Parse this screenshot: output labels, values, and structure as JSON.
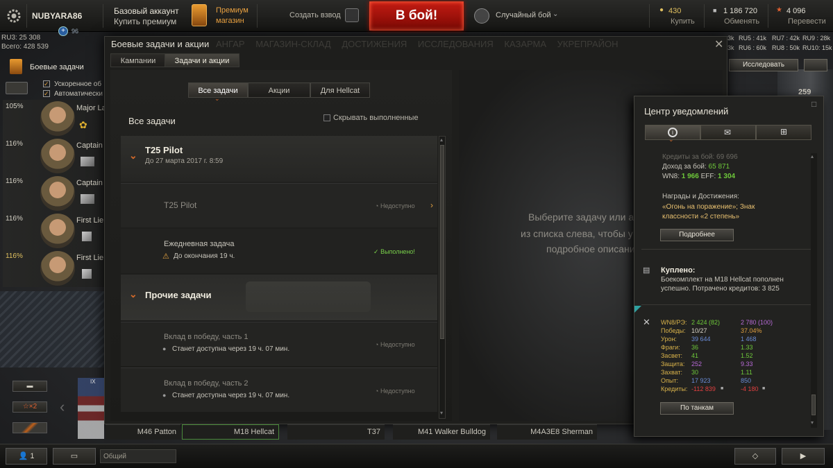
{
  "topbar": {
    "player_name": "NUBYARA86",
    "clan_badge": "96",
    "account_type": "Базовый аккаунт",
    "buy_premium": "Купить премиум",
    "premium_shop_line1": "Премиум",
    "premium_shop_line2": "магазин",
    "create_platoon": "Создать взвод",
    "battle_button": "В бой!",
    "battle_mode": "Случайный бой",
    "gold": "430",
    "gold_action": "Купить",
    "credits": "1 186 720",
    "credits_action": "Обменять",
    "free_xp": "4 096",
    "free_xp_action": "Перевести"
  },
  "left_stats": {
    "ru3": "RU3: 25 308",
    "total": "Всего: 428 539"
  },
  "left_menu": {
    "missions_label": "Боевые задачи",
    "option_accelerated": "Ускоренное об",
    "option_auto": "Автоматически"
  },
  "crew": [
    {
      "percent": "105%",
      "rank": "Major La"
    },
    {
      "percent": "116%",
      "rank": "Captain"
    },
    {
      "percent": "116%",
      "rank": "Captain"
    },
    {
      "percent": "116%",
      "rank": "First Lie"
    },
    {
      "percent": "116%",
      "rank": "First Lie"
    }
  ],
  "server_stats": {
    "ru5": "RU5 : 41k",
    "ru7": "RU7 : 42k",
    "ru9": "RU9 : 28k",
    "ru6": "RU6 : 60k",
    "ru8": "RU8 : 50k",
    "ru10": "RU10: 15k",
    "left_a": "3k",
    "left_b": "3k"
  },
  "garage_menu": {
    "items": [
      "АНГАР",
      "МАГАЗИН-СКЛАД",
      "ДОСТИЖЕНИЯ",
      "ИССЛЕДОВАНИЯ",
      "КАЗАРМА",
      "УКРЕПРАЙОН"
    ],
    "research_button": "Исследовать",
    "tank_name_bg": "Hellcat",
    "tank_level_num": "259"
  },
  "modal": {
    "title": "Боевые задачи и акции",
    "tabs": [
      "Кампании",
      "Задачи и акции"
    ],
    "filter_tabs": [
      "Все задачи",
      "Акции",
      "Для Hellcat"
    ],
    "section_title": "Все задачи",
    "hide_completed": "Скрывать выполненные",
    "group1_title": "T25 Pilot",
    "group1_date": "До 27 марта 2017 г. 8:59",
    "task1_name": "T25 Pilot",
    "task1_status": "Недоступно",
    "task2_name": "Ежедневная задача",
    "task2_sub": "До окончания 19 ч.",
    "task2_status": "Выполнено!",
    "group2_title": "Прочие задачи",
    "task3_name": "Вклад в победу, часть 1",
    "task3_sub": "Станет доступна через 19 ч. 07 мин.",
    "task3_status": "Недоступно",
    "task4_name": "Вклад в победу, часть 2",
    "task4_sub": "Станет доступна через 19 ч. 07 мин.",
    "task4_status": "Недоступно",
    "detail_line1": "Выберите задачу или ак",
    "detail_line2": "из списка слева, чтобы у",
    "detail_line3": "подробное описани"
  },
  "notifications": {
    "title": "Центр уведомлений",
    "credits_battle": "Кредиты за бой: 69 696",
    "income_label": "Доход за бой:",
    "income_value": "65 871",
    "wn8_label": "WN8:",
    "wn8_value": "1 966",
    "eff_label": "EFF:",
    "eff_value": "1 304",
    "awards_label": "Награды и Достижения:",
    "awards_line1": "«Огонь на поражение»; Знак",
    "awards_line2": "классности «2 степень»",
    "details_button": "Подробнее",
    "purchased_title": "Куплено:",
    "purchased_line1": "Боекомплект на M18 Hellcat пополнен",
    "purchased_line2": "успешно. Потрачено кредитов:",
    "purchased_value": "3 825",
    "stats_rows": [
      {
        "key": "WN8/РЭ:",
        "v1": "2 424 (82)",
        "v2": "2 780 (100)",
        "c1": "#6ec93a",
        "c2": "#b76ad6"
      },
      {
        "key": "Победы:",
        "v1": "10/27",
        "v2": "37.04%",
        "c1": "#d8d4c8",
        "c2": "#e0a040"
      },
      {
        "key": "Урон:",
        "v1": "39 644",
        "v2": "1 468",
        "c1": "#6a8cd6",
        "c2": "#6a8cd6"
      },
      {
        "key": "Фраги:",
        "v1": "36",
        "v2": "1.33",
        "c1": "#6ec93a",
        "c2": "#6ec93a"
      },
      {
        "key": "Засвет:",
        "v1": "41",
        "v2": "1.52",
        "c1": "#6ec93a",
        "c2": "#6ec93a"
      },
      {
        "key": "Защита:",
        "v1": "252",
        "v2": "9.33",
        "c1": "#b76ad6",
        "c2": "#b76ad6"
      },
      {
        "key": "Захват:",
        "v1": "30",
        "v2": "1.11",
        "c1": "#6ec93a",
        "c2": "#6ec93a"
      },
      {
        "key": "Опыт:",
        "v1": "17 923",
        "v2": "850",
        "c1": "#6a8cd6",
        "c2": "#6a8cd6"
      },
      {
        "key": "Кредиты:",
        "v1": "-112 839",
        "v2": "-4 180",
        "c1": "#e04040",
        "c2": "#e04040"
      }
    ],
    "by_tanks_button": "По танкам"
  },
  "carousel": {
    "tanks": [
      "M46 Patton",
      "M18 Hellcat",
      "T37",
      "M41 Walker Bulldog",
      "M4A3E8 Sherman"
    ],
    "tier_badge": "IX",
    "xp_bonus": "×2"
  },
  "bottombar": {
    "friends_count": "1",
    "chat_channel": "Общий"
  },
  "colors": {
    "accent_orange": "#d46a2a",
    "battle_red": "#c21b12",
    "gold": "#e0c060",
    "completed_green": "#7ad14a"
  }
}
